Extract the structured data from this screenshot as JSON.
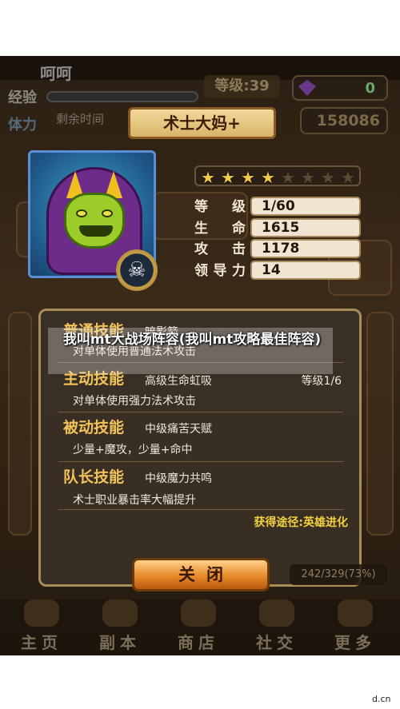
{
  "player": {
    "name": "呵呵",
    "exp_label": "经验",
    "level_text": "等级:39",
    "gems": "0",
    "stamina_label": "体力",
    "remain_time_label": "剩余时间",
    "gold": "158086"
  },
  "hero": {
    "name": "术士大妈+",
    "stars_filled": 4,
    "stars_total": 8,
    "stats": [
      {
        "label": "等级",
        "value": "1/60"
      },
      {
        "label": "生命",
        "value": "1615"
      },
      {
        "label": "攻击",
        "value": "1178"
      },
      {
        "label": "领导力",
        "value": "14"
      }
    ]
  },
  "skills": {
    "normal": {
      "name": "普通技能",
      "detail": "暗影箭",
      "desc": "对单体使用普通法术攻击"
    },
    "active": {
      "name": "主动技能",
      "detail": "高级生命虹吸",
      "level": "等级1/6",
      "desc": "对单体使用强力法术攻击"
    },
    "passive": {
      "name": "被动技能",
      "detail": "中级痛苦天赋",
      "desc": "少量+魔攻，少量+命中"
    },
    "leader": {
      "name": "队长技能",
      "detail": "中级魔力共鸣",
      "desc": "术士职业暴击率大幅提升"
    },
    "acquire": "获得途径:英雄进化"
  },
  "buttons": {
    "close": "关闭"
  },
  "collection": {
    "progress": "242/329(73%)"
  },
  "nav": [
    {
      "label": "主页",
      "icon": "home-icon"
    },
    {
      "label": "副本",
      "icon": "dungeon-icon"
    },
    {
      "label": "商店",
      "icon": "shop-icon"
    },
    {
      "label": "社交",
      "icon": "social-icon"
    },
    {
      "label": "更多",
      "icon": "more-icon"
    }
  ],
  "caption": "我叫mt大战场阵容(我叫mt攻略最佳阵容)",
  "watermark": "d.cn"
}
